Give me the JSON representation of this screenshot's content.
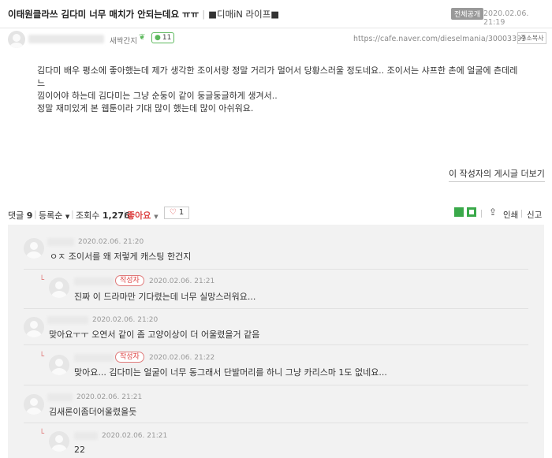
{
  "post": {
    "title": "이태원클라쓰 김다미 너무 매치가 안되는데요 ㅠㅠ",
    "board": "■디매iN 라이프■",
    "visibility": "전체공개",
    "datetime": "2020.02.06. 21:19",
    "author_rank": "새싹간지",
    "comment_count_badge": "11",
    "url": "https://cafe.naver.com/dieselmania/30003393",
    "copy_address_label": "주소복사",
    "body": [
      "김다미 배우 평소에 좋아했는데 제가 생각한 조이서랑 정말 거리가 멀어서 당황스러울 정도네요.. 조이서는 샤프한 촌에 얼굴에 츤데레 느",
      "낌이어야 하는데 김다미는 그냥 순둥이 같이 둥글둥글하게 생겨서..",
      "정말 재미있게 본 웹툰이라 기대 많이 했는데 많이 아쉬워요."
    ],
    "more_posts_label": "이 작성자의 게시글 더보기"
  },
  "stats": {
    "comments_label": "댓글",
    "comments_count": "9",
    "sort_label": "등록순",
    "views_label": "조회수",
    "views_count": "1,276",
    "like_label": "좋아요",
    "like_count": "1",
    "share_label": "인쇄",
    "report_label": "신고"
  },
  "comments": [
    {
      "date": "2020.02.06. 21:20",
      "text": "ㅇㅈ 조이서를 왜 저렇게 캐스팅 한건지",
      "reply": false,
      "is_author": false
    },
    {
      "date": "2020.02.06. 21:21",
      "text": "진짜 이 드라마만 기다렸는데 너무 실망스러워요...",
      "reply": true,
      "is_author": true
    },
    {
      "date": "2020.02.06. 21:20",
      "text": "맞아요ㅜㅜ 오연서 같이 좀 고양이상이 더 어울렸을거 같음",
      "reply": false,
      "is_author": false
    },
    {
      "date": "2020.02.06. 21:22",
      "text": "맞아요... 김다미는 얼굴이 너무 동그래서 단발머리를 하니 그냥 카리스마 1도 없네요...",
      "reply": true,
      "is_author": true
    },
    {
      "date": "2020.02.06. 21:21",
      "text": "김새론이좀더어울렸을듯",
      "reply": false,
      "is_author": false
    },
    {
      "date": "2020.02.06. 21:21",
      "text": "22",
      "reply": true,
      "is_author": false
    }
  ],
  "author_tag_label": "작성자",
  "colors": {
    "like": "#dd4444",
    "green": "#3aa94a",
    "badge_gray": "#999999",
    "comment_bg": "#f2f2f2"
  }
}
